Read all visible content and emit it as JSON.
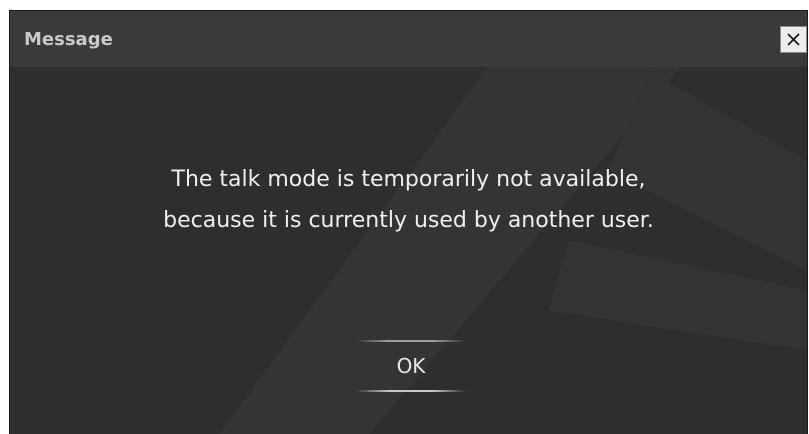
{
  "dialog": {
    "title": "Message",
    "close_icon": "close-icon",
    "message_lines": [
      "The talk mode is temporarily not available,",
      "because it is currently used by another user."
    ],
    "ok_label": "OK"
  },
  "colors": {
    "dialog_background": "#2e2e2e",
    "titlebar_background": "#3a3a3a",
    "text": "#eeeeee"
  }
}
